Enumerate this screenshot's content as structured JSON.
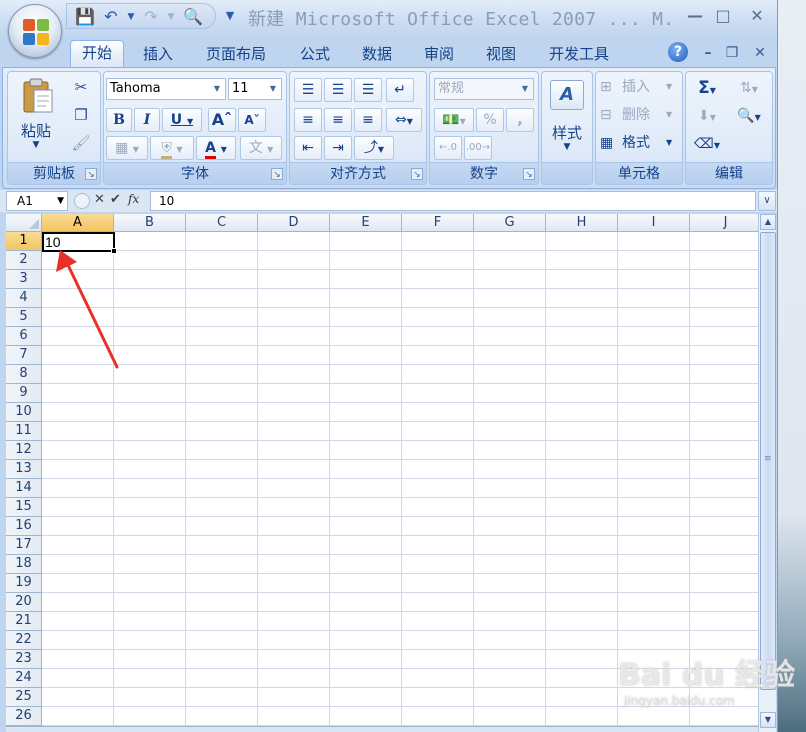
{
  "window": {
    "title": "新建 Microsoft Office Excel 2007 ...  M."
  },
  "tabs": [
    {
      "label": "开始"
    },
    {
      "label": "插入"
    },
    {
      "label": "页面布局"
    },
    {
      "label": "公式"
    },
    {
      "label": "数据"
    },
    {
      "label": "审阅"
    },
    {
      "label": "视图"
    },
    {
      "label": "开发工具"
    }
  ],
  "ribbon": {
    "clipboard": {
      "label": "剪贴板",
      "paste_label": "粘贴"
    },
    "font": {
      "label": "字体",
      "font_name": "Tahoma",
      "font_size": "11",
      "bold": "B",
      "italic": "I",
      "underline": "U"
    },
    "alignment": {
      "label": "对齐方式"
    },
    "number": {
      "label": "数字",
      "format": "常规",
      "percent": "%",
      "comma": ","
    },
    "styles": {
      "label": "",
      "button": "样式"
    },
    "cells": {
      "label": "单元格",
      "insert": "插入",
      "delete": "删除",
      "format": "格式"
    },
    "editing": {
      "label": "编辑"
    }
  },
  "formula_bar": {
    "name_box": "A1",
    "fx": "fx",
    "value": "10"
  },
  "grid": {
    "columns": [
      "A",
      "B",
      "C",
      "D",
      "E",
      "F",
      "G",
      "H",
      "I",
      "J"
    ],
    "rows": [
      "1",
      "2",
      "3",
      "4",
      "5",
      "6",
      "7",
      "8",
      "9",
      "10",
      "11",
      "12",
      "13",
      "14",
      "15",
      "16",
      "17",
      "18",
      "19",
      "20",
      "21",
      "22",
      "23",
      "24",
      "25",
      "26"
    ],
    "selected_cell": "A1",
    "cell_a1": "10"
  },
  "watermark": {
    "main": "Bai du 经验",
    "sub": "jingyan.baidu.com"
  },
  "colors": {
    "ribbon_text": "#15428b",
    "annotation_arrow": "#e8302a",
    "selection_header": "#f2c560"
  }
}
